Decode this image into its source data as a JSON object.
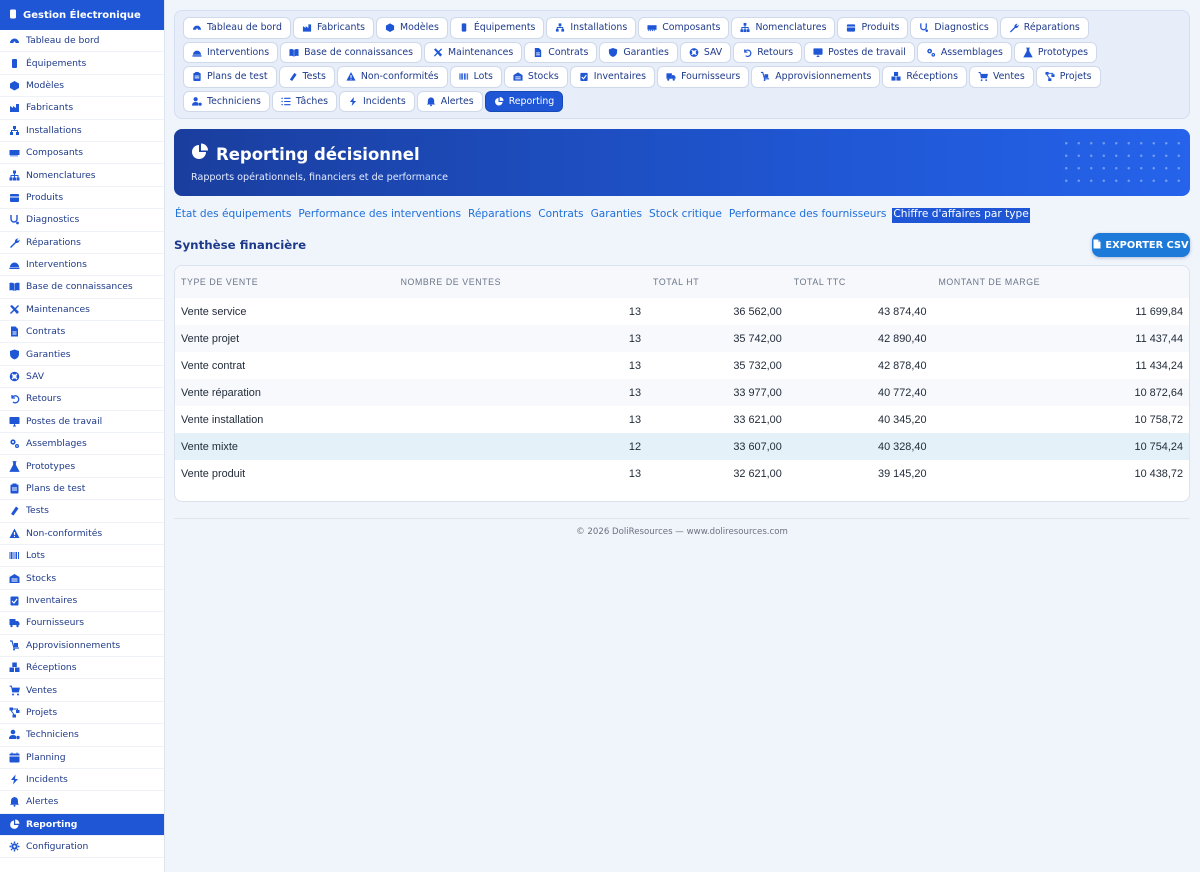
{
  "brand": {
    "title": "Gestion Électronique"
  },
  "sidebar": {
    "items": [
      {
        "label": "Tableau de bord",
        "icon": "gauge-icon"
      },
      {
        "label": "Équipements",
        "icon": "chip-icon"
      },
      {
        "label": "Modèles",
        "icon": "cube-icon"
      },
      {
        "label": "Fabricants",
        "icon": "factory-icon"
      },
      {
        "label": "Installations",
        "icon": "network-icon"
      },
      {
        "label": "Composants",
        "icon": "memory-icon"
      },
      {
        "label": "Nomenclatures",
        "icon": "sitemap-icon"
      },
      {
        "label": "Produits",
        "icon": "box-icon"
      },
      {
        "label": "Diagnostics",
        "icon": "stethoscope-icon"
      },
      {
        "label": "Réparations",
        "icon": "wrench-icon"
      },
      {
        "label": "Interventions",
        "icon": "helmet-icon"
      },
      {
        "label": "Base de connaissances",
        "icon": "book-icon"
      },
      {
        "label": "Maintenances",
        "icon": "tools-icon"
      },
      {
        "label": "Contrats",
        "icon": "file-icon"
      },
      {
        "label": "Garanties",
        "icon": "shield-icon"
      },
      {
        "label": "SAV",
        "icon": "lifebuoy-icon"
      },
      {
        "label": "Retours",
        "icon": "undo-icon"
      },
      {
        "label": "Postes de travail",
        "icon": "desktop-icon"
      },
      {
        "label": "Assemblages",
        "icon": "cogs-icon"
      },
      {
        "label": "Prototypes",
        "icon": "flask-icon"
      },
      {
        "label": "Plans de test",
        "icon": "clipboard-icon"
      },
      {
        "label": "Tests",
        "icon": "vial-icon"
      },
      {
        "label": "Non-conformités",
        "icon": "warning-icon"
      },
      {
        "label": "Lots",
        "icon": "barcode-icon"
      },
      {
        "label": "Stocks",
        "icon": "warehouse-icon"
      },
      {
        "label": "Inventaires",
        "icon": "clipboard-check-icon"
      },
      {
        "label": "Fournisseurs",
        "icon": "truck-icon"
      },
      {
        "label": "Approvisionnements",
        "icon": "dolly-icon"
      },
      {
        "label": "Réceptions",
        "icon": "boxes-icon"
      },
      {
        "label": "Ventes",
        "icon": "cart-icon"
      },
      {
        "label": "Projets",
        "icon": "project-diagram-icon"
      },
      {
        "label": "Techniciens",
        "icon": "user-gear-icon"
      },
      {
        "label": "Planning",
        "icon": "calendar-icon"
      },
      {
        "label": "Incidents",
        "icon": "bolt-icon"
      },
      {
        "label": "Alertes",
        "icon": "bell-icon"
      },
      {
        "label": "Reporting",
        "icon": "pie-chart-icon",
        "active": true
      },
      {
        "label": "Configuration",
        "icon": "gear-icon"
      }
    ]
  },
  "modnav": {
    "items": [
      {
        "label": "Tableau de bord",
        "icon": "gauge-icon"
      },
      {
        "label": "Fabricants",
        "icon": "factory-icon"
      },
      {
        "label": "Modèles",
        "icon": "cube-icon"
      },
      {
        "label": "Équipements",
        "icon": "chip-icon"
      },
      {
        "label": "Installations",
        "icon": "network-icon"
      },
      {
        "label": "Composants",
        "icon": "memory-icon"
      },
      {
        "label": "Nomenclatures",
        "icon": "sitemap-icon"
      },
      {
        "label": "Produits",
        "icon": "box-icon"
      },
      {
        "label": "Diagnostics",
        "icon": "stethoscope-icon"
      },
      {
        "label": "Réparations",
        "icon": "wrench-icon"
      },
      {
        "label": "Interventions",
        "icon": "helmet-icon"
      },
      {
        "label": "Base de connaissances",
        "icon": "book-icon"
      },
      {
        "label": "Maintenances",
        "icon": "tools-icon"
      },
      {
        "label": "Contrats",
        "icon": "file-icon"
      },
      {
        "label": "Garanties",
        "icon": "shield-icon"
      },
      {
        "label": "SAV",
        "icon": "lifebuoy-icon"
      },
      {
        "label": "Retours",
        "icon": "undo-icon"
      },
      {
        "label": "Postes de travail",
        "icon": "desktop-icon"
      },
      {
        "label": "Assemblages",
        "icon": "cogs-icon"
      },
      {
        "label": "Prototypes",
        "icon": "flask-icon"
      },
      {
        "label": "Plans de test",
        "icon": "clipboard-icon"
      },
      {
        "label": "Tests",
        "icon": "vial-icon"
      },
      {
        "label": "Non-conformités",
        "icon": "warning-icon"
      },
      {
        "label": "Lots",
        "icon": "barcode-icon"
      },
      {
        "label": "Stocks",
        "icon": "warehouse-icon"
      },
      {
        "label": "Inventaires",
        "icon": "clipboard-check-icon"
      },
      {
        "label": "Fournisseurs",
        "icon": "truck-icon"
      },
      {
        "label": "Approvisionnements",
        "icon": "dolly-icon"
      },
      {
        "label": "Réceptions",
        "icon": "boxes-icon"
      },
      {
        "label": "Ventes",
        "icon": "cart-icon"
      },
      {
        "label": "Projets",
        "icon": "project-diagram-icon"
      },
      {
        "label": "Techniciens",
        "icon": "user-gear-icon"
      },
      {
        "label": "Tâches",
        "icon": "list-icon"
      },
      {
        "label": "Incidents",
        "icon": "bolt-icon"
      },
      {
        "label": "Alertes",
        "icon": "bell-icon"
      },
      {
        "label": "Reporting",
        "icon": "pie-chart-icon",
        "active": true
      }
    ]
  },
  "header": {
    "title": "Reporting décisionnel",
    "subtitle": "Rapports opérationnels, financiers et de performance"
  },
  "report_tabs": [
    {
      "label": "État des équipements"
    },
    {
      "label": "Performance des interventions"
    },
    {
      "label": "Réparations"
    },
    {
      "label": "Contrats"
    },
    {
      "label": "Garanties"
    },
    {
      "label": "Stock critique"
    },
    {
      "label": "Performance des fournisseurs"
    },
    {
      "label": "Chiffre d'affaires par type",
      "active": true
    }
  ],
  "section": {
    "title": "Synthèse financière"
  },
  "export": {
    "label": "EXPORTER CSV"
  },
  "table": {
    "columns": [
      "Type de vente",
      "Nombre de ventes",
      "Total HT",
      "Total TTC",
      "Montant de marge"
    ],
    "rows": [
      [
        "Vente service",
        "13",
        "36 562,00",
        "43 874,40",
        "11 699,84"
      ],
      [
        "Vente projet",
        "13",
        "35 742,00",
        "42 890,40",
        "11 437,44"
      ],
      [
        "Vente contrat",
        "13",
        "35 732,00",
        "42 878,40",
        "11 434,24"
      ],
      [
        "Vente réparation",
        "13",
        "33 977,00",
        "40 772,40",
        "10 872,64"
      ],
      [
        "Vente installation",
        "13",
        "33 621,00",
        "40 345,20",
        "10 758,72"
      ],
      [
        "Vente mixte",
        "12",
        "33 607,00",
        "40 328,40",
        "10 754,24"
      ],
      [
        "Vente produit",
        "13",
        "32 621,00",
        "39 145,20",
        "10 438,72"
      ]
    ],
    "highlighted_row": 5
  },
  "footer": {
    "text": "© 2026 DoliResources — www.doliresources.com"
  },
  "colors": {
    "primary": "#1f56d6",
    "link": "#1e6fd9",
    "export": "#1e7ad9"
  }
}
